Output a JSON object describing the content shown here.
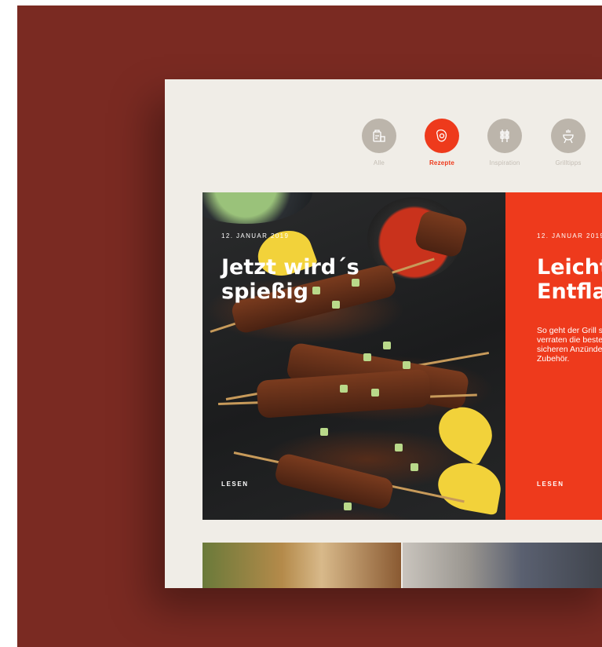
{
  "nav": {
    "categories": [
      {
        "label": "Alle",
        "icon": "grocery-bag-icon"
      },
      {
        "label": "Rezepte",
        "icon": "steak-icon"
      },
      {
        "label": "Inspiration",
        "icon": "skewers-icon"
      },
      {
        "label": "Grilltipps",
        "icon": "grill-icon"
      }
    ],
    "active": "Rezepte"
  },
  "cards": [
    {
      "date": "12. JANUAR 2019",
      "title": "Jetzt wird´s spießig",
      "read": "LESEN",
      "image": "grilled-skewers-photo"
    },
    {
      "date": "12. JANUAR 2019",
      "title": "Leicht\nEntflam",
      "description": "So geht der Grill si\nverraten die beste\nsicheren Anzünder\nZubehör.",
      "read": "LESEN"
    }
  ],
  "thumbnails": [
    {
      "image": "outdoor-picnic-photo"
    },
    {
      "image": "family-grilling-photo"
    }
  ],
  "colors": {
    "backdrop": "#7a2a22",
    "page": "#f0ede7",
    "accent": "#ee3a1c",
    "inactive_icon": "#bcb5ab"
  }
}
